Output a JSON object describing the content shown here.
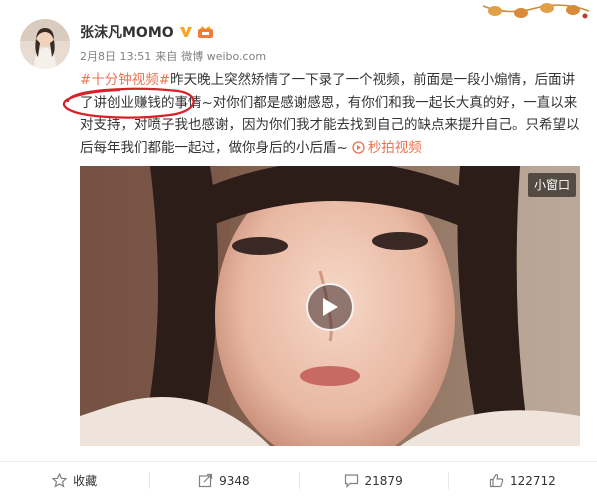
{
  "post": {
    "author": "张沫凡MOMO",
    "date": "2月8日 13:51",
    "source_prefix": "来自",
    "source": "微博 weibo.com",
    "topic": "#十分钟视频#",
    "text": "昨天晚上突然矫情了一下录了一个视频，前面是一段小煽情，后面讲了讲创业赚钱的事情~对你们都是感谢感恩，有你们和我一起长大真的好，一直以来对支持，对喷子我也感谢，因为你们我才能去找到自己的缺点来提升自己。只希望以后每年我们都能一起过，做你身后的小后盾~",
    "video_link": "秒拍视频"
  },
  "video": {
    "mini_window_label": "小窗口"
  },
  "actions": [
    {
      "label": "收藏",
      "icon": "star-icon"
    },
    {
      "label": "9348",
      "icon": "share-icon"
    },
    {
      "label": "21879",
      "icon": "comment-icon"
    },
    {
      "label": "122712",
      "icon": "like-icon"
    }
  ],
  "colors": {
    "accent": "#eb7350",
    "circle": "#d8222a",
    "verified": "#f5a623"
  }
}
